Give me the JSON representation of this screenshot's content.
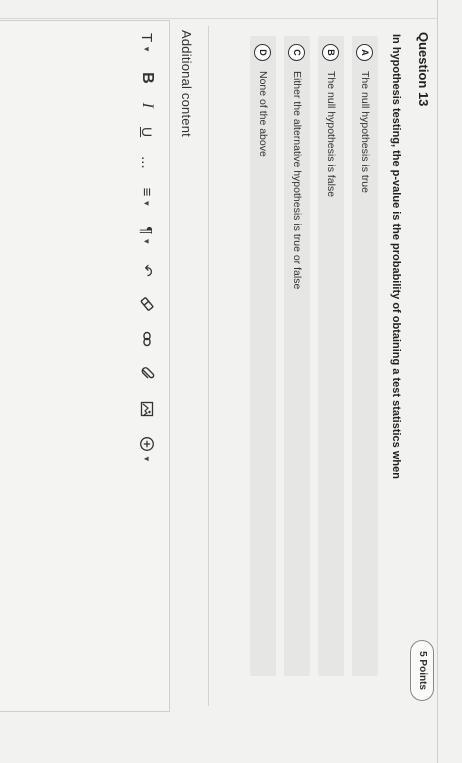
{
  "question": {
    "title": "Question 13",
    "points": "5 Points",
    "text": "In hypothesis testing, the p-value is the probability of obtaining a test statistics when"
  },
  "options": [
    {
      "letter": "A",
      "text": "The null hypothesis is true"
    },
    {
      "letter": "B",
      "text": "The null hypothesis is false"
    },
    {
      "letter": "C",
      "text": "Either the alternative hypothesis is true or false"
    },
    {
      "letter": "D",
      "text": "None of the above"
    }
  ],
  "additional": {
    "label": "Additional content"
  },
  "toolbar": {
    "text_style": "T",
    "bold": "B",
    "italic": "I",
    "underline": "U",
    "more": "...",
    "list": "≡",
    "paragraph": "¶",
    "undo": "↶",
    "insert_add": "+",
    "icons": [
      "text-style-icon",
      "bold-icon",
      "italic-icon",
      "underline-icon",
      "more-icon",
      "list-icon",
      "paragraph-icon",
      "undo-icon",
      "eraser-icon",
      "link-icon",
      "attachment-icon",
      "image-icon",
      "insert-add-icon"
    ]
  }
}
